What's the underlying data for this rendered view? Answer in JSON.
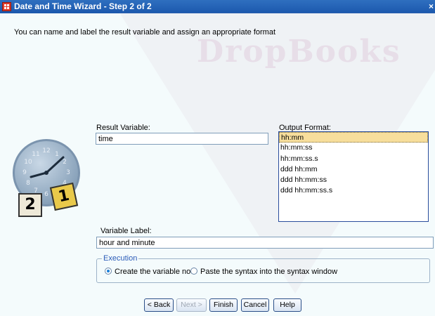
{
  "window": {
    "title": "Date and Time Wizard - Step 2 of 2",
    "close_glyph": "×"
  },
  "watermark": "DropBooks",
  "intro": "You can name and label the result variable and assign an appropriate format",
  "result_variable": {
    "label": "Result Variable:",
    "value": "time"
  },
  "output_format": {
    "label": "Output Format:",
    "options": [
      "hh:mm",
      "hh:mm:ss",
      "hh:mm:ss.s",
      "ddd hh:mm",
      "ddd hh:mm:ss",
      "ddd hh:mm:ss.s"
    ],
    "selected": "hh:mm"
  },
  "variable_label": {
    "label": "Variable Label:",
    "value": "hour and minute"
  },
  "execution": {
    "legend": "Execution",
    "option_create": "Create the variable now",
    "option_paste": "Paste the syntax into the syntax window",
    "selected": "create"
  },
  "buttons": {
    "back": "< Back",
    "next": "Next >",
    "finish": "Finish",
    "cancel": "Cancel",
    "help": "Help"
  },
  "illustration": {
    "clock_numbers": [
      "12",
      "1",
      "2",
      "3",
      "4",
      "5",
      "6",
      "7",
      "8",
      "9",
      "10",
      "11"
    ],
    "calendar_left": "2",
    "calendar_right": "1"
  },
  "colors": {
    "title_bar": "#1b58ad",
    "selected_item": "#f7de9c",
    "radio_on": "#1a7fd8"
  }
}
